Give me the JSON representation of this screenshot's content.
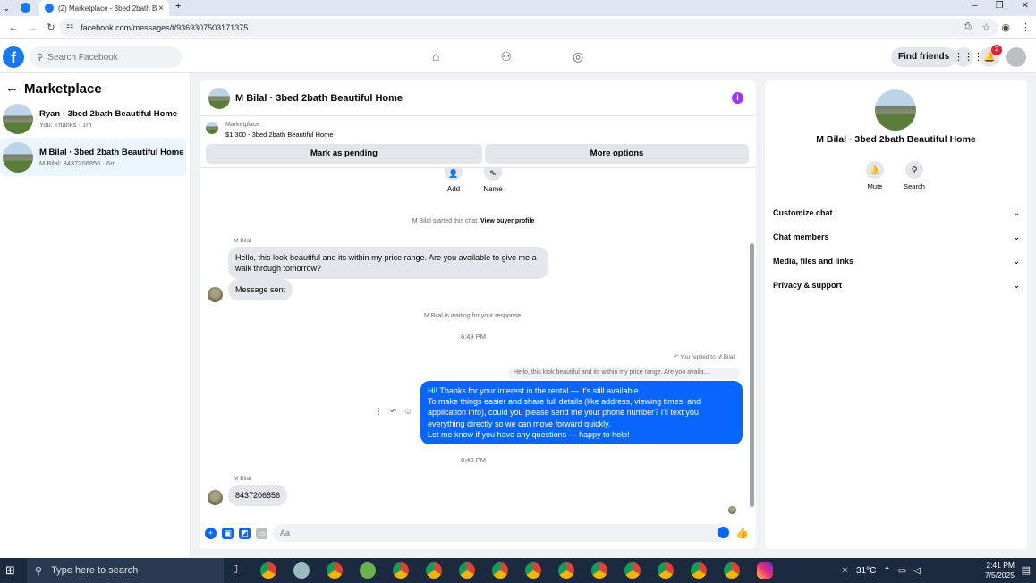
{
  "browser": {
    "tab_title": "(2) Marketplace - 3bed 2bath B",
    "url": "facebook.com/messages/t/9369307503171375"
  },
  "header": {
    "search_placeholder": "Search Facebook",
    "find_friends": "Find friends",
    "notification_count": "2"
  },
  "sidebar": {
    "title": "Marketplace",
    "conversations": [
      {
        "name": "Ryan · 3bed 2bath Beautiful Home",
        "preview": "You: Thanks · 1m"
      },
      {
        "name": "M Bilal · 3bed 2bath Beautiful Home",
        "preview": "M Bilal: 8437206856 · 6m"
      }
    ]
  },
  "chat": {
    "title": "M Bilal · 3bed 2bath Beautiful Home",
    "marketplace_label": "Marketplace",
    "listing": "$1,300 - 3bed 2bath Beautiful Home",
    "mark_pending": "Mark as pending",
    "more_options": "More options",
    "add_label": "Add",
    "name_label": "Name",
    "started_text": "M Bilal started this chat.",
    "view_profile": "View buyer profile",
    "sender_1": "M Bilal",
    "msg_1": "Hello, this look beautiful and its within my price range. Are you available to give me a walk through tomorrow?",
    "msg_2": "Message sent",
    "waiting": "M Bilal is waiting for your response.",
    "time_1": "6:49 PM",
    "replied_note": "You replied to M Bilal",
    "quote": "Hello, this look beautiful and its within my price range. Are you availa...",
    "out_lines": [
      "Hi! Thanks for your interest in the rental — it's still available.",
      "To make things easier and share full details (like address, viewing times, and application info), could you please send me your phone number? I'll text you everything directly so we can move forward quickly.",
      "Let me know if you have any questions — happy to help!"
    ],
    "time_2": "8:40 PM",
    "sender_2": "M Bilal",
    "msg_3": "8437206856",
    "compose_placeholder": "Aa"
  },
  "info_panel": {
    "name": "M Bilal · 3bed 2bath Beautiful Home",
    "mute": "Mute",
    "search": "Search",
    "sections": [
      "Customize chat",
      "Chat members",
      "Media, files and links",
      "Privacy & support"
    ]
  },
  "taskbar": {
    "search": "Type here to search",
    "temp": "31°C",
    "time": "2:41 PM",
    "date": "7/5/2025"
  }
}
